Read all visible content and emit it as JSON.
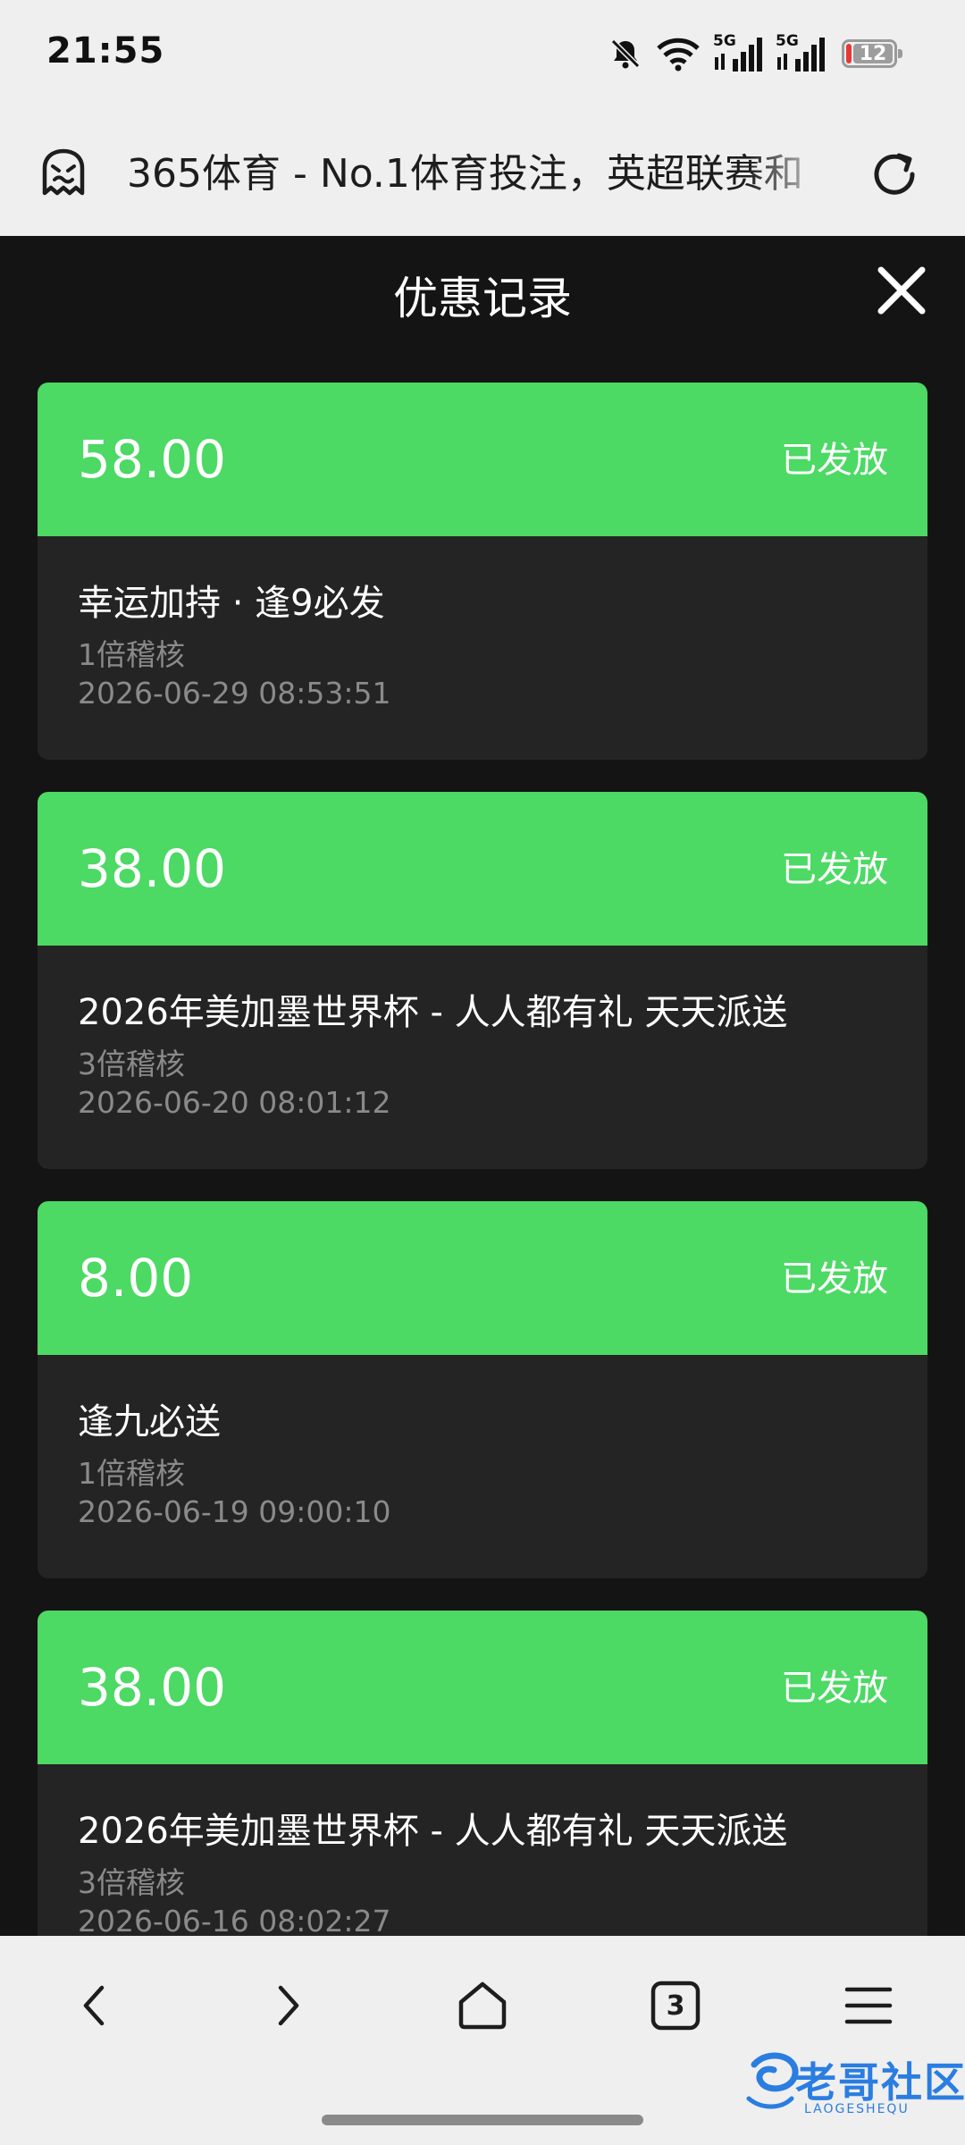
{
  "status_bar": {
    "time": "21:55",
    "network_1": "5G",
    "network_2": "5G",
    "battery_level": "12",
    "battery_color": "#e53935"
  },
  "browser": {
    "address_text": "365体育 - No.1体育投注，英超联赛和",
    "site_icon": "ghost-icon",
    "reload_icon": "reload-icon"
  },
  "page": {
    "title": "优惠记录",
    "close_icon": "close-icon"
  },
  "colors": {
    "card_header": "#4cd964",
    "card_body": "#242424",
    "background": "#141414"
  },
  "records": [
    {
      "amount": "58.00",
      "status": "已发放",
      "name": "幸运加持 · 逢9必发",
      "multiplier": "1倍稽核",
      "time": "2026-06-29 08:53:51"
    },
    {
      "amount": "38.00",
      "status": "已发放",
      "name": "2026年美加墨世界杯  -  人人都有礼 天天派送",
      "multiplier": "3倍稽核",
      "time": "2026-06-20 08:01:12"
    },
    {
      "amount": "8.00",
      "status": "已发放",
      "name": "逢九必送",
      "multiplier": "1倍稽核",
      "time": "2026-06-19 09:00:10"
    },
    {
      "amount": "38.00",
      "status": "已发放",
      "name": "2026年美加墨世界杯  -  人人都有礼 天天派送",
      "multiplier": "3倍稽核",
      "time": "2026-06-16 08:02:27"
    }
  ],
  "bottom_nav": {
    "tabs_count": "3",
    "items": [
      "back-icon",
      "forward-icon",
      "home-icon",
      "tabs-icon",
      "menu-icon"
    ]
  },
  "watermark": {
    "text": "老哥社区",
    "sub": "LAOGESHEQU"
  }
}
